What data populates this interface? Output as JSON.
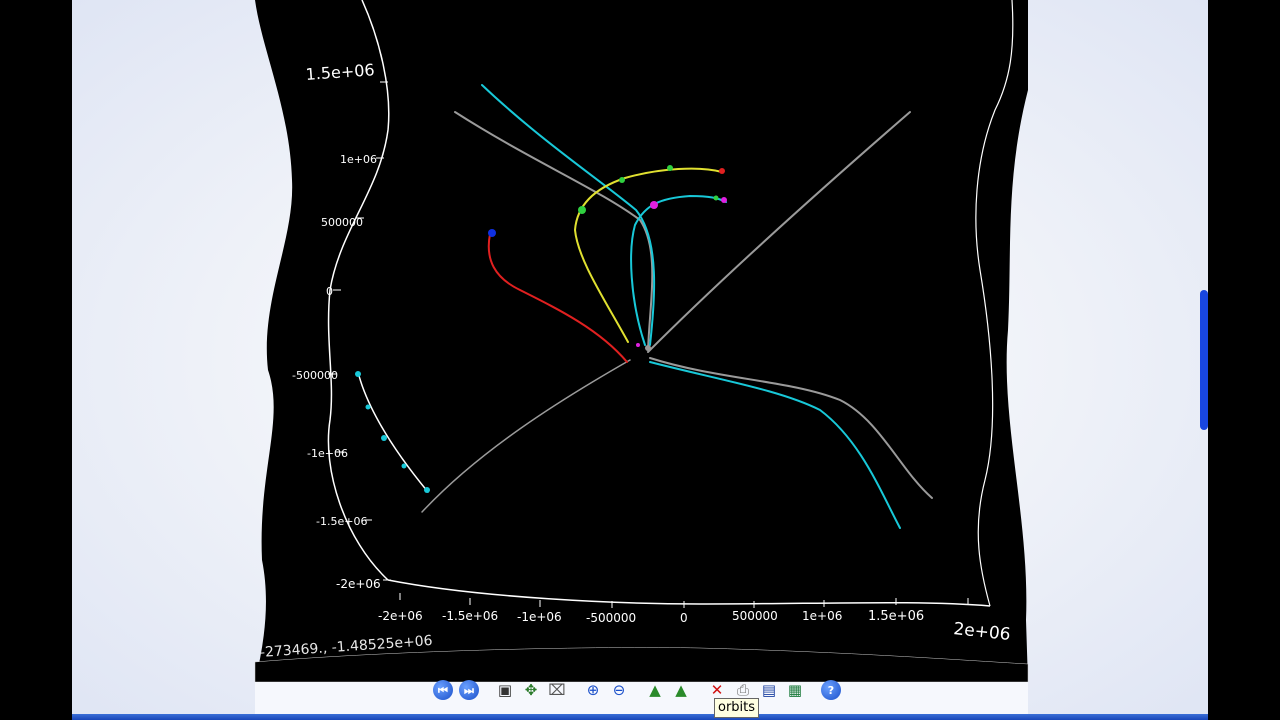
{
  "window": {
    "coordinate_readout": "-273469., -1.48525e+06"
  },
  "plot": {
    "y_ticks": [
      "1.5e+06",
      "1e+06",
      "500000",
      "0",
      "-500000",
      "-1e+06",
      "-1.5e+06",
      "-2e+06"
    ],
    "x_ticks": [
      "-2e+06",
      "-1.5e+06",
      "-1e+06",
      "-500000",
      "0",
      "500000",
      "1e+06",
      "1.5e+06",
      "2e+06"
    ],
    "background_color": "#000000",
    "orbit_colors": [
      "#18c8d8",
      "#9a9a9a",
      "#e0e030",
      "#e02020",
      "#ffffff",
      "#1030e0",
      "#30d040",
      "#e020e0"
    ]
  },
  "toolbar": {
    "buttons": [
      {
        "name": "rewind-icon",
        "glyph": "⏮"
      },
      {
        "name": "fast-forward-icon",
        "glyph": "⏭"
      },
      {
        "name": "fit-view-icon",
        "glyph": "▣"
      },
      {
        "name": "pan-icon",
        "glyph": "✥"
      },
      {
        "name": "crop-icon",
        "glyph": "⌧"
      },
      {
        "name": "zoom-in-icon",
        "glyph": "⊕"
      },
      {
        "name": "zoom-out-icon",
        "glyph": "⊖"
      },
      {
        "name": "mountain-left-icon",
        "glyph": "▲"
      },
      {
        "name": "mountain-right-icon",
        "glyph": "▲"
      },
      {
        "name": "clear-orbits-icon",
        "glyph": "✕"
      },
      {
        "name": "print-icon",
        "glyph": "⎙"
      },
      {
        "name": "save-icon",
        "glyph": "▤"
      },
      {
        "name": "export-image-icon",
        "glyph": "▦"
      },
      {
        "name": "help-icon",
        "glyph": "?"
      }
    ],
    "tooltip": "orbits"
  }
}
